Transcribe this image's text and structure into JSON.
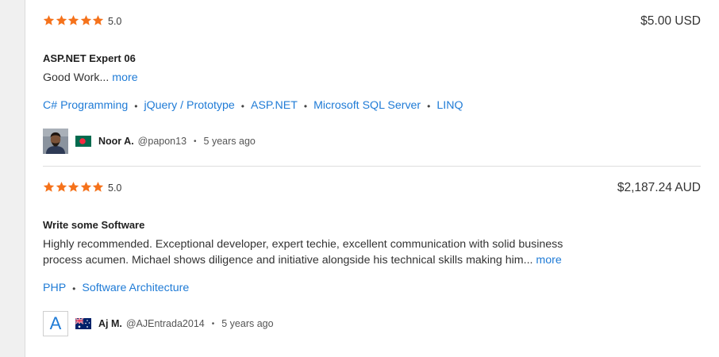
{
  "colors": {
    "star": "#f5721b",
    "link": "#1f7bd6"
  },
  "reviews": [
    {
      "stars": 5,
      "score": "5.0",
      "price": "$5.00 USD",
      "title": "ASP.NET Expert 06",
      "description": "Good Work...",
      "more": "more",
      "skills": [
        "C# Programming",
        "jQuery / Prototype",
        "ASP.NET",
        "Microsoft SQL Server",
        "LINQ"
      ],
      "user": {
        "name": "Noor A.",
        "handle": "@papon13",
        "time": "5 years ago",
        "flag": "bangladesh-flag-icon"
      }
    },
    {
      "stars": 5,
      "score": "5.0",
      "price": "$2,187.24 AUD",
      "title": "Write some Software",
      "description": "Highly recommended. Exceptional developer, expert techie, excellent communication with solid business process acumen. Michael shows diligence and initiative alongside his technical skills making him...",
      "more": "more",
      "skills": [
        "PHP",
        "Software Architecture"
      ],
      "user": {
        "name": "Aj M.",
        "handle": "@AJEntrada2014",
        "time": "5 years ago",
        "flag": "australia-flag-icon",
        "avatar_letter": "A"
      }
    }
  ]
}
